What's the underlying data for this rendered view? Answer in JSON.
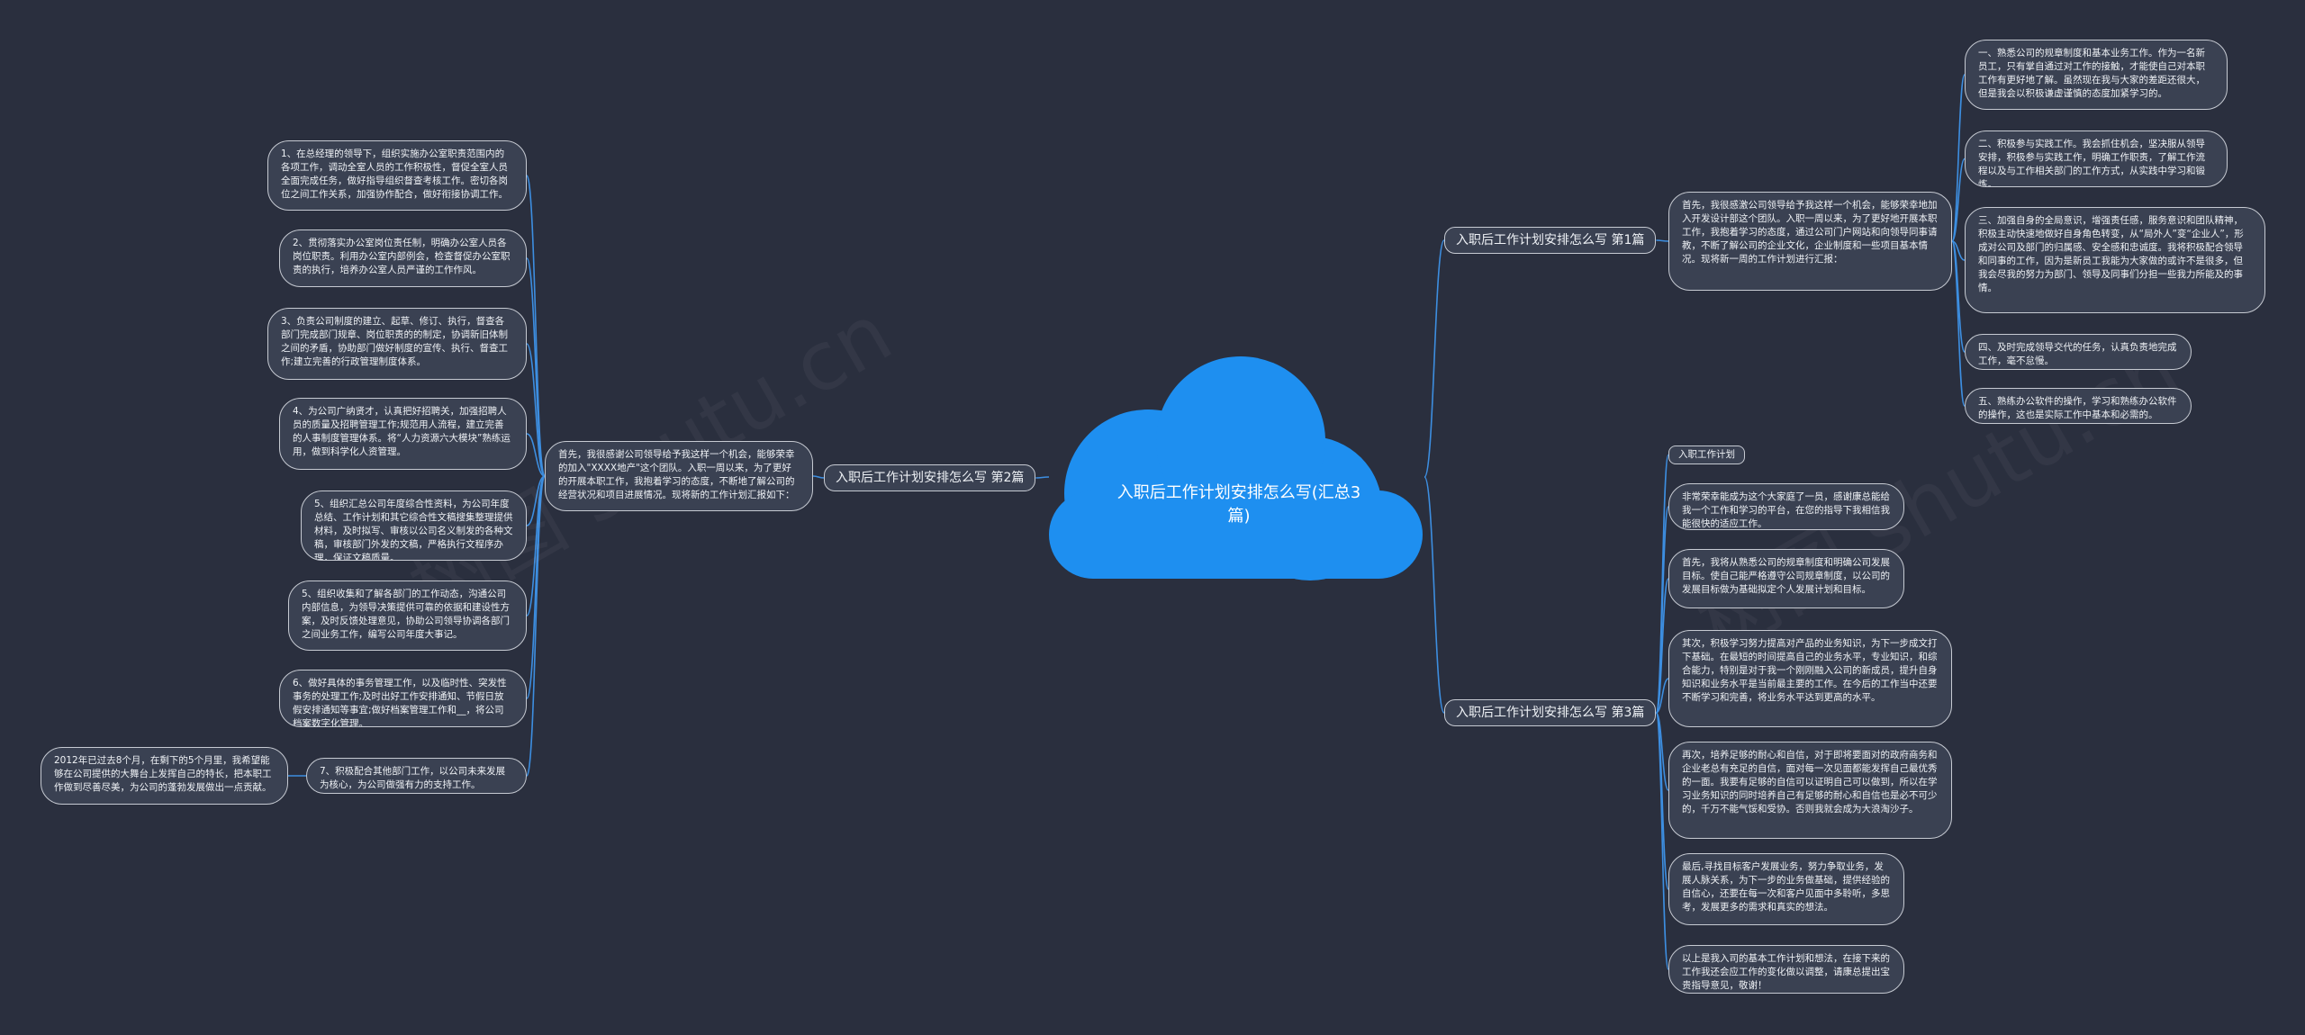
{
  "colors": {
    "background": "#2a2f3e",
    "line": "#3d8ee0",
    "cloud": "#1e8ff0",
    "node_fill": "#3a4152",
    "node_border": "#c6cad2"
  },
  "center": {
    "title": "入职后工作计划安排怎么写(汇总3篇)"
  },
  "watermark": {
    "text": "树图 shutu.cn"
  },
  "branches": {
    "b1": "入职后工作计划安排怎么写 第1篇",
    "b2": "入职后工作计划安排怎么写 第2篇",
    "b3": "入职后工作计划安排怎么写 第3篇"
  },
  "b1": {
    "intro": "首先，我很感激公司领导给予我这样一个机会，能够荣幸地加入开发设计部这个团队。入职一周以来，为了更好地开展本职工作，我抱着学习的态度，通过公司门户网站和向领导同事请教，不断了解公司的企业文化，企业制度和一些项目基本情况。现将新一周的工作计划进行汇报：",
    "items": [
      "一、熟悉公司的规章制度和基本业务工作。作为一名新员工，只有掌自通过对工作的接触，才能使自己对本职工作有更好地了解。虽然现在我与大家的差距还很大，但是我会以积极谦虚谨慎的态度加紧学习的。",
      "二、积极参与实践工作。我会抓住机会，坚决服从领导安排，积极参与实践工作，明确工作职责，了解工作流程以及与工作相关部门的工作方式，从实践中学习和锻炼。",
      "三、加强自身的全局意识，增强责任感，服务意识和团队精神，积极主动快速地做好自身角色转变，从“局外人”变“企业人”，形成对公司及部门的归属感、安全感和忠诚度。我将积极配合领导和同事的工作，因为是新员工我能为大家做的或许不是很多，但我会尽我的努力为部门、领导及同事们分担一些我力所能及的事情。",
      "四、及时完成领导交代的任务，认真负责地完成工作，毫不怠慢。",
      "五、熟练办公软件的操作，学习和熟练办公软件的操作，这也是实际工作中基本和必需的。"
    ]
  },
  "b2": {
    "intro": "首先，我很感谢公司领导给予我这样一个机会，能够荣幸的加入\"XXXX地产\"这个团队。入职一周以来，为了更好的开展本职工作，我抱着学习的态度，不断地了解公司的经营状况和项目进展情况。现将新的工作计划汇报如下：",
    "items": [
      "1、在总经理的领导下，组织实施办公室职责范围内的各项工作，调动全室人员的工作积极性，督促全室人员全面完成任务，做好指导组织督查考核工作。密切各岗位之间工作关系，加强协作配合，做好衔接协调工作。",
      "2、贯彻落实办公室岗位责任制，明确办公室人员各岗位职责。利用办公室内部例会，检查督促办公室职责的执行，培养办公室人员严谨的工作作风。",
      "3、负责公司制度的建立、起草、修订、执行，督查各部门完成部门规章、岗位职责的的制定，协调新旧体制之间的矛盾，协助部门做好制度的宣传、执行、督查工作;建立完善的行政管理制度体系。",
      "4、为公司广纳贤才，认真把好招聘关，加强招聘人员的质量及招聘管理工作;规范用人流程，建立完善的人事制度管理体系。将“人力资源六大模块”熟练运用，做到科学化人资管理。",
      "5、组织汇总公司年度综合性资料，为公司年度总结、工作计划和其它综合性文稿搜集整理提供材料，及时拟写、审核以公司名义制发的各种文稿，审核部门外发的文稿，严格执行文程序办理，保证文稿质量。",
      "5、组织收集和了解各部门的工作动态，沟通公司内部信息，为领导决策提供可靠的依据和建设性方案，及时反馈处理意见，协助公司领导协调各部门之间业务工作，编写公司年度大事记。",
      "6、做好具体的事务管理工作，以及临时性、突发性事务的处理工作;及时出好工作安排通知、节假日放假安排通知等事宜;做好档案管理工作和__，将公司档案数字化管理。",
      "7、积极配合其他部门工作，以公司未来发展为核心，为公司做强有力的支持工作。"
    ],
    "sub": "2012年已过去8个月，在剩下的5个月里，我希望能够在公司提供的大舞台上发挥自己的特长，把本职工作做到尽善尽美，为公司的蓬勃发展做出一点贡献。"
  },
  "b3": {
    "tag": "入职工作计划",
    "items": [
      "非常荣幸能成为这个大家庭了一员，感谢康总能给我一个工作和学习的平台，在您的指导下我相信我能很快的适应工作。",
      "首先，我将从熟悉公司的规章制度和明确公司发展目标。使自己能严格遵守公司规章制度，以公司的发展目标做为基础拟定个人发展计划和目标。",
      "其次，积极学习努力提高对产品的业务知识，为下一步成文打下基础。在最短的时间提高自己的业务水平，专业知识，和综合能力，特别是对于我一个刚刚融入公司的新成员，提升自身知识和业务水平是当前最主要的工作。在今后的工作当中还要不断学习和完善，将业务水平达到更高的水平。",
      "再次，培养足够的耐心和自信，对于即将要面对的政府商务和企业老总有充足的自信，面对每一次见面都能发挥自己最优秀的一面。我要有足够的自信可以证明自己可以做到，所以在学习业务知识的同时培养自己有足够的耐心和自信也是必不可少的，千万不能气馁和受协。否则我就会成为大浪淘沙子。",
      "最后,寻找目标客户发展业务，努力争取业务，发展人脉关系，为下一步的业务做基础，提供经验的自信心，还要在每一次和客户见面中多聆听，多思考，发展更多的需求和真实的想法。",
      "以上是我入司的基本工作计划和想法，在接下来的工作我还会应工作的变化做以调整，请康总提出宝贵指导意见，敬谢！"
    ]
  }
}
